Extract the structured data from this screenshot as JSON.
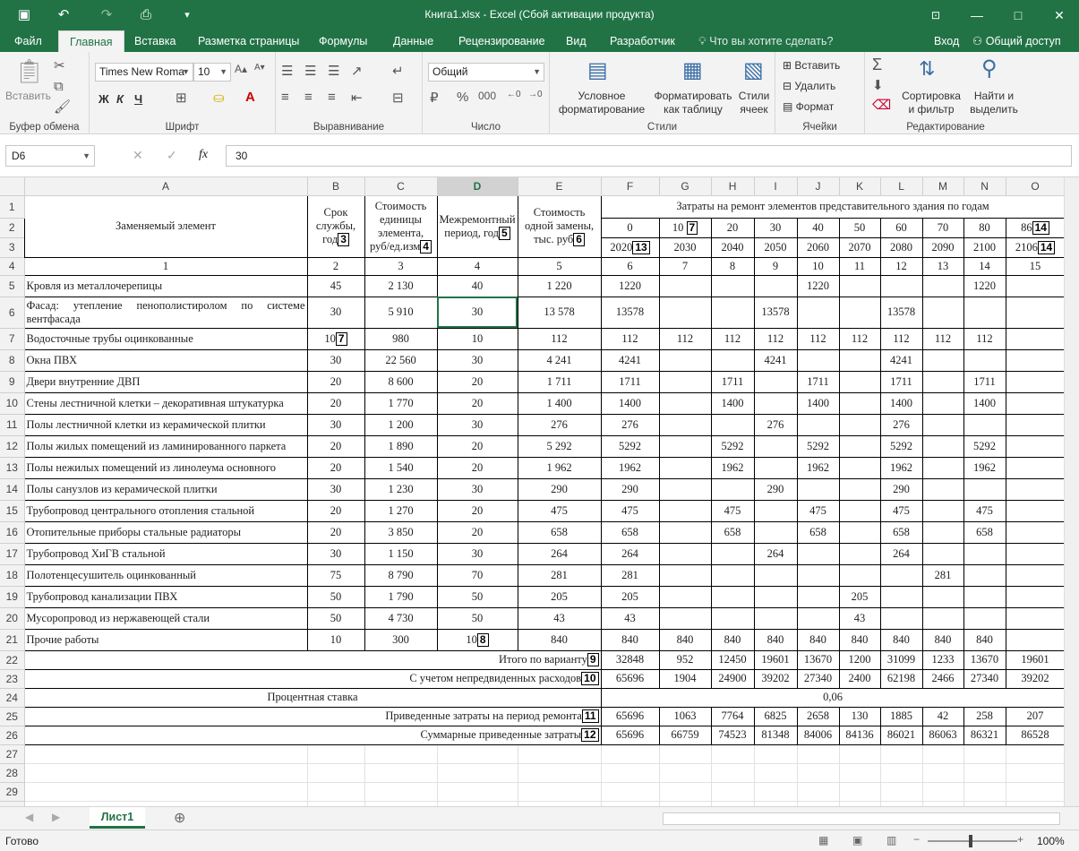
{
  "window": {
    "title": "Книга1.xlsx - Excel (Сбой активации продукта)"
  },
  "menu": {
    "tabs": [
      "Файл",
      "Главная",
      "Вставка",
      "Разметка страницы",
      "Формулы",
      "Данные",
      "Рецензирование",
      "Вид",
      "Разработчик"
    ],
    "tell_me": "Что вы хотите сделать?",
    "signin": "Вход",
    "share": "Общий доступ"
  },
  "ribbon": {
    "clipboard": {
      "paste": "Вставить",
      "label": "Буфер обмена"
    },
    "font": {
      "name": "Times New Roma",
      "size": "10",
      "bold": "Ж",
      "italic": "К",
      "underline": "Ч",
      "label": "Шрифт"
    },
    "align": {
      "label": "Выравнивание"
    },
    "number": {
      "format": "Общий",
      "label": "Число"
    },
    "styles": {
      "cond1": "Условное",
      "cond2": "форматирование",
      "table1": "Форматировать",
      "table2": "как таблицу",
      "cell1": "Стили",
      "cell2": "ячеек",
      "label": "Стили"
    },
    "cells": {
      "insert": "Вставить",
      "delete": "Удалить",
      "format": "Формат",
      "label": "Ячейки"
    },
    "edit": {
      "sort1": "Сортировка",
      "sort2": "и фильтр",
      "find1": "Найти и",
      "find2": "выделить",
      "label": "Редактирование"
    }
  },
  "formula_bar": {
    "cell_ref": "D6",
    "value": "30",
    "fx": "fx"
  },
  "columns": [
    "A",
    "B",
    "C",
    "D",
    "E",
    "F",
    "G",
    "H",
    "I",
    "J",
    "K",
    "L",
    "M",
    "N",
    "O"
  ],
  "header": {
    "a": "Заменяемый элемент",
    "b": "Срок службы, год",
    "c": "Стоимость единицы элемента, руб/ед.изм",
    "d": "Межремонтный период, год",
    "e": "Стоимость одной замены, тыс. руб",
    "costs_title": "Затраты на ремонт элементов представительного здания по годам",
    "row2": [
      "0",
      "10",
      "20",
      "30",
      "40",
      "50",
      "60",
      "70",
      "80",
      "86"
    ],
    "row3": [
      "2020",
      "2030",
      "2040",
      "2050",
      "2060",
      "2070",
      "2080",
      "2090",
      "2100",
      "2106"
    ],
    "nums": [
      "1",
      "2",
      "3",
      "4",
      "5",
      "6",
      "7",
      "8",
      "9",
      "10",
      "11",
      "12",
      "13",
      "14",
      "15"
    ]
  },
  "rows": [
    {
      "a": "Кровля из металлочерепицы",
      "b": "45",
      "c": "2 130",
      "d": "40",
      "e": "1 220",
      "y": [
        "1220",
        "",
        "",
        "",
        "1220",
        "",
        "",
        "",
        "1220",
        ""
      ]
    },
    {
      "a": "Фасад: утепление пенополистиролом по системе вентфасада",
      "b": "30",
      "c": "5 910",
      "d": "30",
      "e": "13 578",
      "y": [
        "13578",
        "",
        "",
        "13578",
        "",
        "",
        "13578",
        "",
        "",
        ""
      ]
    },
    {
      "a": "Водосточные трубы оцинкованные",
      "b": "10",
      "c": "980",
      "d": "10",
      "e": "112",
      "y": [
        "112",
        "112",
        "112",
        "112",
        "112",
        "112",
        "112",
        "112",
        "112",
        ""
      ]
    },
    {
      "a": "Окна ПВХ",
      "b": "30",
      "c": "22 560",
      "d": "30",
      "e": "4 241",
      "y": [
        "4241",
        "",
        "",
        "4241",
        "",
        "",
        "4241",
        "",
        "",
        ""
      ]
    },
    {
      "a": "Двери внутренние ДВП",
      "b": "20",
      "c": "8 600",
      "d": "20",
      "e": "1 711",
      "y": [
        "1711",
        "",
        "1711",
        "",
        "1711",
        "",
        "1711",
        "",
        "1711",
        ""
      ]
    },
    {
      "a": "Стены лестничной клетки – декоративная штукатурка",
      "b": "20",
      "c": "1 770",
      "d": "20",
      "e": "1 400",
      "y": [
        "1400",
        "",
        "1400",
        "",
        "1400",
        "",
        "1400",
        "",
        "1400",
        ""
      ]
    },
    {
      "a": "Полы лестничной клетки из керамической плитки",
      "b": "30",
      "c": "1 200",
      "d": "30",
      "e": "276",
      "y": [
        "276",
        "",
        "",
        "276",
        "",
        "",
        "276",
        "",
        "",
        ""
      ]
    },
    {
      "a": "Полы жилых помещений из ламинированного паркета",
      "b": "20",
      "c": "1 890",
      "d": "20",
      "e": "5 292",
      "y": [
        "5292",
        "",
        "5292",
        "",
        "5292",
        "",
        "5292",
        "",
        "5292",
        ""
      ]
    },
    {
      "a": "Полы нежилых помещений из линолеума основного",
      "b": "20",
      "c": "1 540",
      "d": "20",
      "e": "1 962",
      "y": [
        "1962",
        "",
        "1962",
        "",
        "1962",
        "",
        "1962",
        "",
        "1962",
        ""
      ]
    },
    {
      "a": "Полы санузлов из керамической плитки",
      "b": "30",
      "c": "1 230",
      "d": "30",
      "e": "290",
      "y": [
        "290",
        "",
        "",
        "290",
        "",
        "",
        "290",
        "",
        "",
        ""
      ]
    },
    {
      "a": "Трубопровод центрального отопления стальной",
      "b": "20",
      "c": "1 270",
      "d": "20",
      "e": "475",
      "y": [
        "475",
        "",
        "475",
        "",
        "475",
        "",
        "475",
        "",
        "475",
        ""
      ]
    },
    {
      "a": "Отопительные приборы стальные радиаторы",
      "b": "20",
      "c": "3 850",
      "d": "20",
      "e": "658",
      "y": [
        "658",
        "",
        "658",
        "",
        "658",
        "",
        "658",
        "",
        "658",
        ""
      ]
    },
    {
      "a": "Трубопровод ХиГВ стальной",
      "b": "30",
      "c": "1 150",
      "d": "30",
      "e": "264",
      "y": [
        "264",
        "",
        "",
        "264",
        "",
        "",
        "264",
        "",
        "",
        ""
      ]
    },
    {
      "a": "Полотенцесушитель оцинкованный",
      "b": "75",
      "c": "8 790",
      "d": "70",
      "e": "281",
      "y": [
        "281",
        "",
        "",
        "",
        "",
        "",
        "",
        "281",
        "",
        ""
      ]
    },
    {
      "a": "Трубопровод канализации ПВХ",
      "b": "50",
      "c": "1 790",
      "d": "50",
      "e": "205",
      "y": [
        "205",
        "",
        "",
        "",
        "",
        "205",
        "",
        "",
        "",
        ""
      ]
    },
    {
      "a": "Мусоропровод из нержавеющей стали",
      "b": "50",
      "c": "4 730",
      "d": "50",
      "e": "43",
      "y": [
        "43",
        "",
        "",
        "",
        "",
        "43",
        "",
        "",
        "",
        ""
      ]
    },
    {
      "a": "Прочие работы",
      "b": "10",
      "c": "300",
      "d": "10",
      "e": "840",
      "y": [
        "840",
        "840",
        "840",
        "840",
        "840",
        "840",
        "840",
        "840",
        "840",
        ""
      ]
    }
  ],
  "summary": [
    {
      "label": "Итого по варианту",
      "y": [
        "32848",
        "952",
        "12450",
        "19601",
        "13670",
        "1200",
        "31099",
        "1233",
        "13670",
        "19601"
      ]
    },
    {
      "label": "С учетом непредвиденных расходов",
      "y": [
        "65696",
        "1904",
        "24900",
        "39202",
        "27340",
        "2400",
        "62198",
        "2466",
        "27340",
        "39202"
      ]
    },
    {
      "label": "Процентная ставка",
      "rate": "0,06"
    },
    {
      "label": "Приведенные затраты на период ремонта",
      "y": [
        "65696",
        "1063",
        "7764",
        "6825",
        "2658",
        "130",
        "1885",
        "42",
        "258",
        "207"
      ]
    },
    {
      "label": "Суммарные приведенные затраты",
      "y": [
        "65696",
        "66759",
        "74523",
        "81348",
        "84006",
        "84136",
        "86021",
        "86063",
        "86321",
        "86528"
      ]
    }
  ],
  "badges": {
    "b3": "3",
    "b4": "4",
    "b5": "5",
    "b6": "6",
    "b7": "7",
    "b7b": "7",
    "b8": "8",
    "b9": "9",
    "b10": "10",
    "b11": "11",
    "b12": "12",
    "b13": "13",
    "b14": "14",
    "b14b": "14"
  },
  "sheet_tab": "Лист1",
  "status": {
    "ready": "Готово",
    "zoom": "100%"
  }
}
